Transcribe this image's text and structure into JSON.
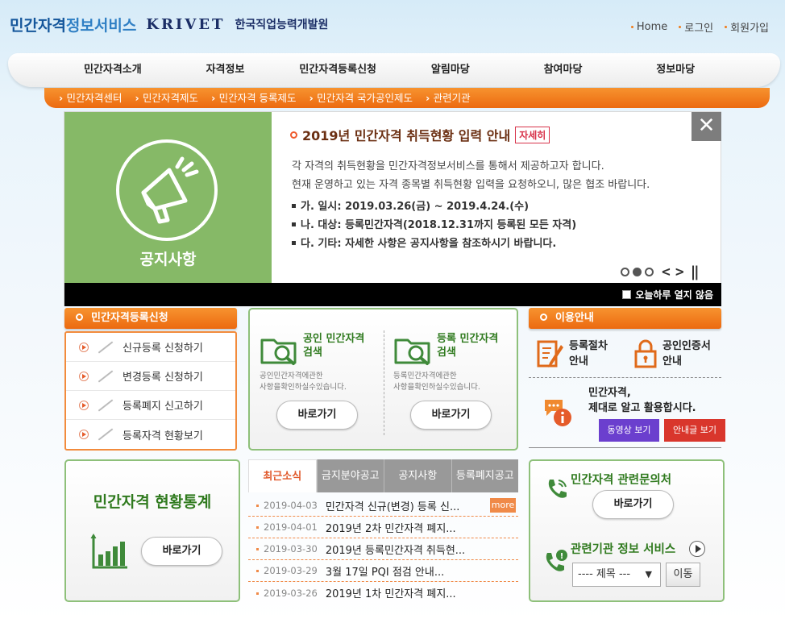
{
  "header": {
    "site_title_a": "민간자격",
    "site_title_b": "정보서비스",
    "krivet": "KRIVET",
    "org_name": "한국직업능력개발원",
    "links": [
      "Home",
      "로그인",
      "회원가입"
    ]
  },
  "gnb": [
    "민간자격소개",
    "자격정보",
    "민간자격등록신청",
    "알림마당",
    "참여마당",
    "정보마당"
  ],
  "lnb": [
    "민간자격센터",
    "민간자격제도",
    "민간자격 등록제도",
    "민간자격 국가공인제도",
    "관련기관"
  ],
  "banner": {
    "category": "공지사항",
    "title": "2019년 민간자격 취득현황 입력 안내",
    "detail_label": "자세히",
    "close_label": "✕",
    "desc_line1": "각 자격의 취득현황을 민간자격정보서비스를 통해서 제공하고자 합니다.",
    "desc_line2": "현재 운영하고 있는 자격 종목별 취득현황 입력을 요청하오니, 많은 협조 바랍니다.",
    "items": [
      "가. 일시: 2019.03.26(금) ~ 2019.4.24.(수)",
      "나. 대상: 등록민간자격(2018.12.31까지 등록된 모든 자격)",
      "다. 기타: 자세한 사항은 공지사항을 참조하시기 바랍니다."
    ],
    "page_indicator": {
      "total": 3,
      "current": 2
    },
    "dont_show_label": "오늘하루 열지 않음"
  },
  "registration": {
    "heading": "민간자격등록신청",
    "items": [
      "신규등록 신청하기",
      "변경등록 신청하기",
      "등록폐지 신고하기",
      "등록자격 현황보기"
    ]
  },
  "search": {
    "public": {
      "title1": "공인 민간자격",
      "title2": "검색",
      "sub1": "공인민간자격에관한",
      "sub2": "사항을확인하실수있습니다.",
      "button": "바로가기"
    },
    "registered": {
      "title1": "등록 민간자격",
      "title2": "검색",
      "sub1": "등록민간자격에관한",
      "sub2": "사항을확인하실수있습니다.",
      "button": "바로가기"
    }
  },
  "usage": {
    "heading": "이용안내",
    "procedure": {
      "line1": "등록절차",
      "line2": "안내"
    },
    "certificate": {
      "line1": "공인인증서",
      "line2": "안내"
    },
    "message_line1": "민간자격,",
    "message_line2": "제대로 알고 활용합시다.",
    "video_button": "동영상 보기",
    "guide_button": "안내글 보기"
  },
  "stats": {
    "title": "민간자격 현황통계",
    "button": "바로가기"
  },
  "news": {
    "tabs": [
      "최근소식",
      "금지분야공고",
      "공지사항",
      "등록폐지공고"
    ],
    "active_tab": 0,
    "more_label": "more",
    "rows": [
      {
        "date": "2019-04-03",
        "title": "민간자격 신규(변경) 등록 신..."
      },
      {
        "date": "2019-04-01",
        "title": "2019년 2차 민간자격 폐지..."
      },
      {
        "date": "2019-03-30",
        "title": "2019년 등록민간자격 취득현..."
      },
      {
        "date": "2019-03-29",
        "title": "3월 17일 PQI 점검 안내..."
      },
      {
        "date": "2019-03-26",
        "title": "2019년 1차 민간자격 폐지..."
      }
    ]
  },
  "contact": {
    "title": "민간자격 관련문의처",
    "button": "바로가기",
    "related_title": "관련기관 정보 서비스",
    "select_value": "---- 제목 ---",
    "move_button": "이동"
  },
  "colors": {
    "accent_orange": "#ec6a10",
    "green": "#86b967",
    "dark_green": "#2f7a1e"
  }
}
